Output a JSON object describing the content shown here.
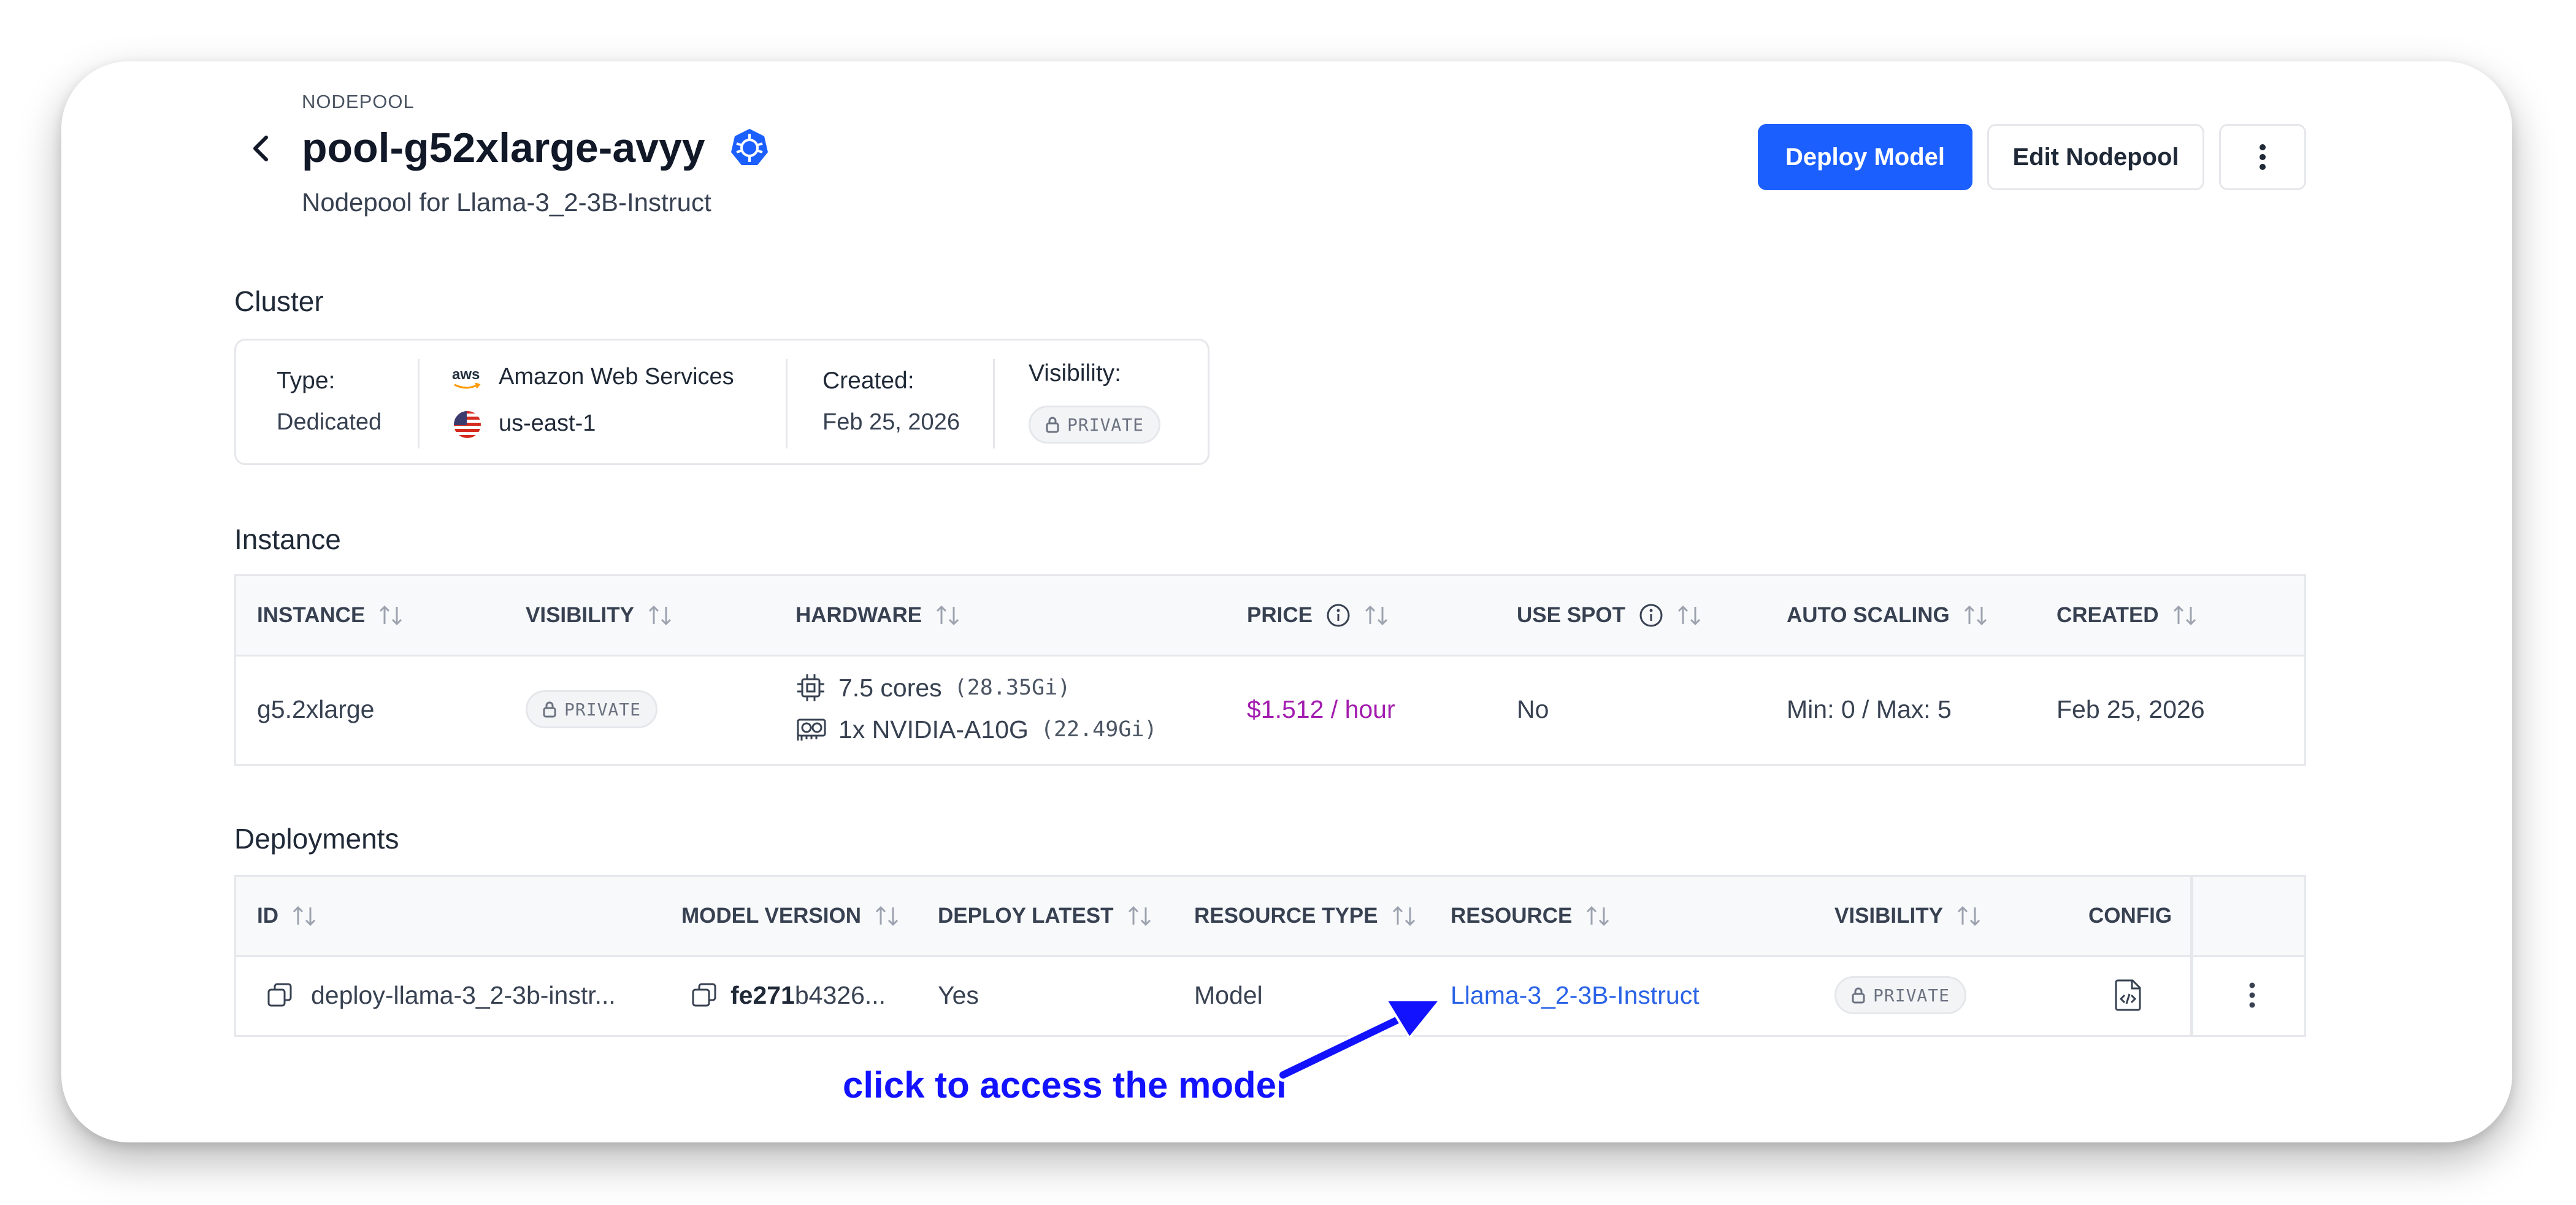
{
  "header": {
    "eyebrow": "NODEPOOL",
    "title": "pool-g52xlarge-avyy",
    "subtitle": "Nodepool for Llama-3_2-3B-Instruct",
    "deploy_button": "Deploy Model",
    "edit_button": "Edit Nodepool"
  },
  "cluster": {
    "section_title": "Cluster",
    "type_label": "Type:",
    "type_value": "Dedicated",
    "provider_logo": "aws",
    "provider": "Amazon Web Services",
    "region": "us-east-1",
    "created_label": "Created:",
    "created_value": "Feb 25, 2026",
    "visibility_label": "Visibility:",
    "visibility_value": "PRIVATE"
  },
  "instance": {
    "section_title": "Instance",
    "columns": [
      "INSTANCE",
      "VISIBILITY",
      "HARDWARE",
      "PRICE",
      "USE SPOT",
      "AUTO SCALING",
      "CREATED"
    ],
    "row": {
      "instance": "g5.2xlarge",
      "visibility": "PRIVATE",
      "cpu": "7.5 cores",
      "cpu_mem": "(28.35Gi)",
      "gpu": "1x NVIDIA-A10G",
      "gpu_mem": "(22.49Gi)",
      "price": "$1.512 / hour",
      "use_spot": "No",
      "auto_scaling": "Min: 0 / Max: 5",
      "created": "Feb 25, 2026"
    }
  },
  "deployments": {
    "section_title": "Deployments",
    "columns": [
      "ID",
      "MODEL VERSION",
      "DEPLOY LATEST",
      "RESOURCE TYPE",
      "RESOURCE",
      "VISIBILITY",
      "CONFIG"
    ],
    "row": {
      "id": "deploy-llama-3_2-3b-instr...",
      "model_version_bold": "fe271",
      "model_version_rest": "b4326...",
      "deploy_latest": "Yes",
      "resource_type": "Model",
      "resource": "Llama-3_2-3B-Instruct",
      "visibility": "PRIVATE"
    }
  },
  "annotation": {
    "text": "click to access the model"
  },
  "colors": {
    "primary": "#1b5fff",
    "link": "#2a63e6",
    "price": "#a21caf",
    "annotation": "#1212ff"
  }
}
